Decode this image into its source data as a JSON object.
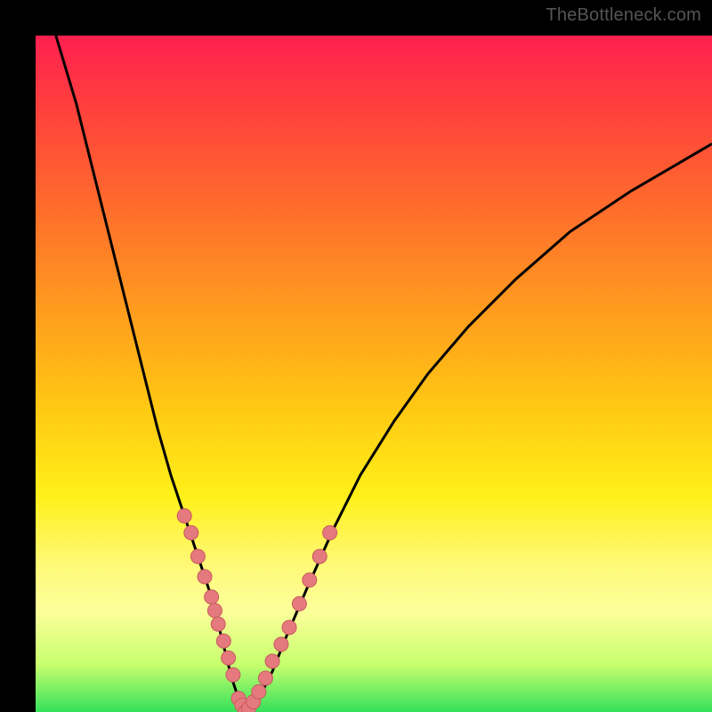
{
  "watermark": "TheBottleneck.com",
  "chart_data": {
    "type": "line",
    "title": "",
    "xlabel": "",
    "ylabel": "",
    "xlim": [
      0,
      100
    ],
    "ylim": [
      0,
      100
    ],
    "series": [
      {
        "name": "left-curve",
        "x": [
          3,
          6,
          9,
          12,
          15,
          18,
          20,
          22,
          24,
          26,
          27,
          28,
          29,
          30,
          31
        ],
        "y": [
          100,
          90,
          78,
          66,
          54,
          42,
          35,
          29,
          23,
          17,
          13,
          9,
          5,
          2,
          0
        ]
      },
      {
        "name": "right-curve",
        "x": [
          31,
          33,
          35,
          37,
          40,
          44,
          48,
          53,
          58,
          64,
          71,
          79,
          88,
          100
        ],
        "y": [
          0,
          2,
          6,
          11,
          18,
          27,
          35,
          43,
          50,
          57,
          64,
          71,
          77,
          84
        ]
      }
    ],
    "markers": {
      "name": "marker-points",
      "x": [
        22,
        23,
        24,
        25,
        26,
        26.5,
        27,
        27.8,
        28.5,
        29.2,
        30,
        30.5,
        31,
        31.5,
        32.2,
        33,
        34,
        35,
        36.3,
        37.5,
        39,
        40.5,
        42,
        43.5
      ],
      "y": [
        29,
        26.5,
        23,
        20,
        17,
        15,
        13,
        10.5,
        8,
        5.5,
        2,
        1,
        0,
        0.5,
        1.5,
        3,
        5,
        7.5,
        10,
        12.5,
        16,
        19.5,
        23,
        26.5
      ]
    },
    "background_gradient": {
      "top": "#ff2050",
      "mid": "#ffe018",
      "bottom": "#35e05a"
    },
    "curve_color": "#000000",
    "marker_color": "#e47a7d"
  }
}
